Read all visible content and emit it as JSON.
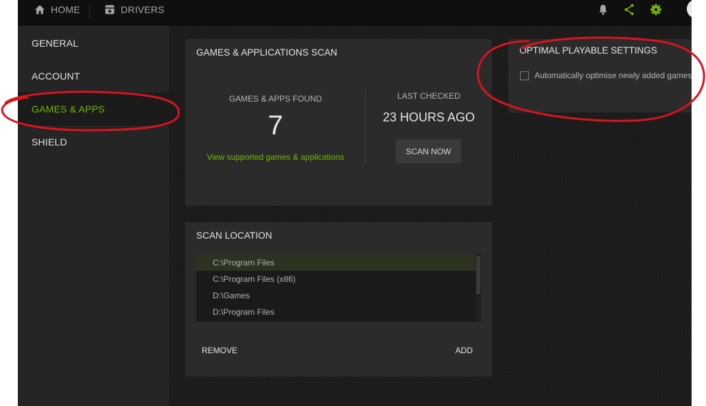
{
  "topbar": {
    "home_label": "HOME",
    "drivers_label": "DRIVERS",
    "icons": [
      "home-icon",
      "drivers-icon",
      "bell-icon",
      "share-icon",
      "gear-icon"
    ],
    "accent": "#76b900"
  },
  "sidebar": {
    "items": [
      {
        "label": "GENERAL",
        "active": false
      },
      {
        "label": "ACCOUNT",
        "active": false
      },
      {
        "label": "GAMES & APPS",
        "active": true
      },
      {
        "label": "SHIELD",
        "active": false
      }
    ]
  },
  "scan": {
    "title": "GAMES & APPLICATIONS SCAN",
    "found_label": "GAMES & APPS FOUND",
    "found_count": "7",
    "supported_link": "View supported games & applications",
    "last_checked_label": "LAST CHECKED",
    "last_checked_value": "23 HOURS AGO",
    "scan_now_label": "SCAN NOW"
  },
  "scan_location": {
    "title": "SCAN LOCATION",
    "paths": [
      "C:\\Program Files",
      "C:\\Program Files (x86)",
      "D:\\Games",
      "D:\\Program Files"
    ],
    "remove_label": "REMOVE",
    "add_label": "ADD"
  },
  "optimal": {
    "title": "OPTIMAL PLAYABLE SETTINGS",
    "auto_label": "Automatically optimise newly added games",
    "auto_checked": false
  },
  "colors": {
    "background": "#1b1b1b",
    "panel": "#2b2b2b",
    "sidebar": "#252525",
    "annotation": "#d9141e"
  }
}
